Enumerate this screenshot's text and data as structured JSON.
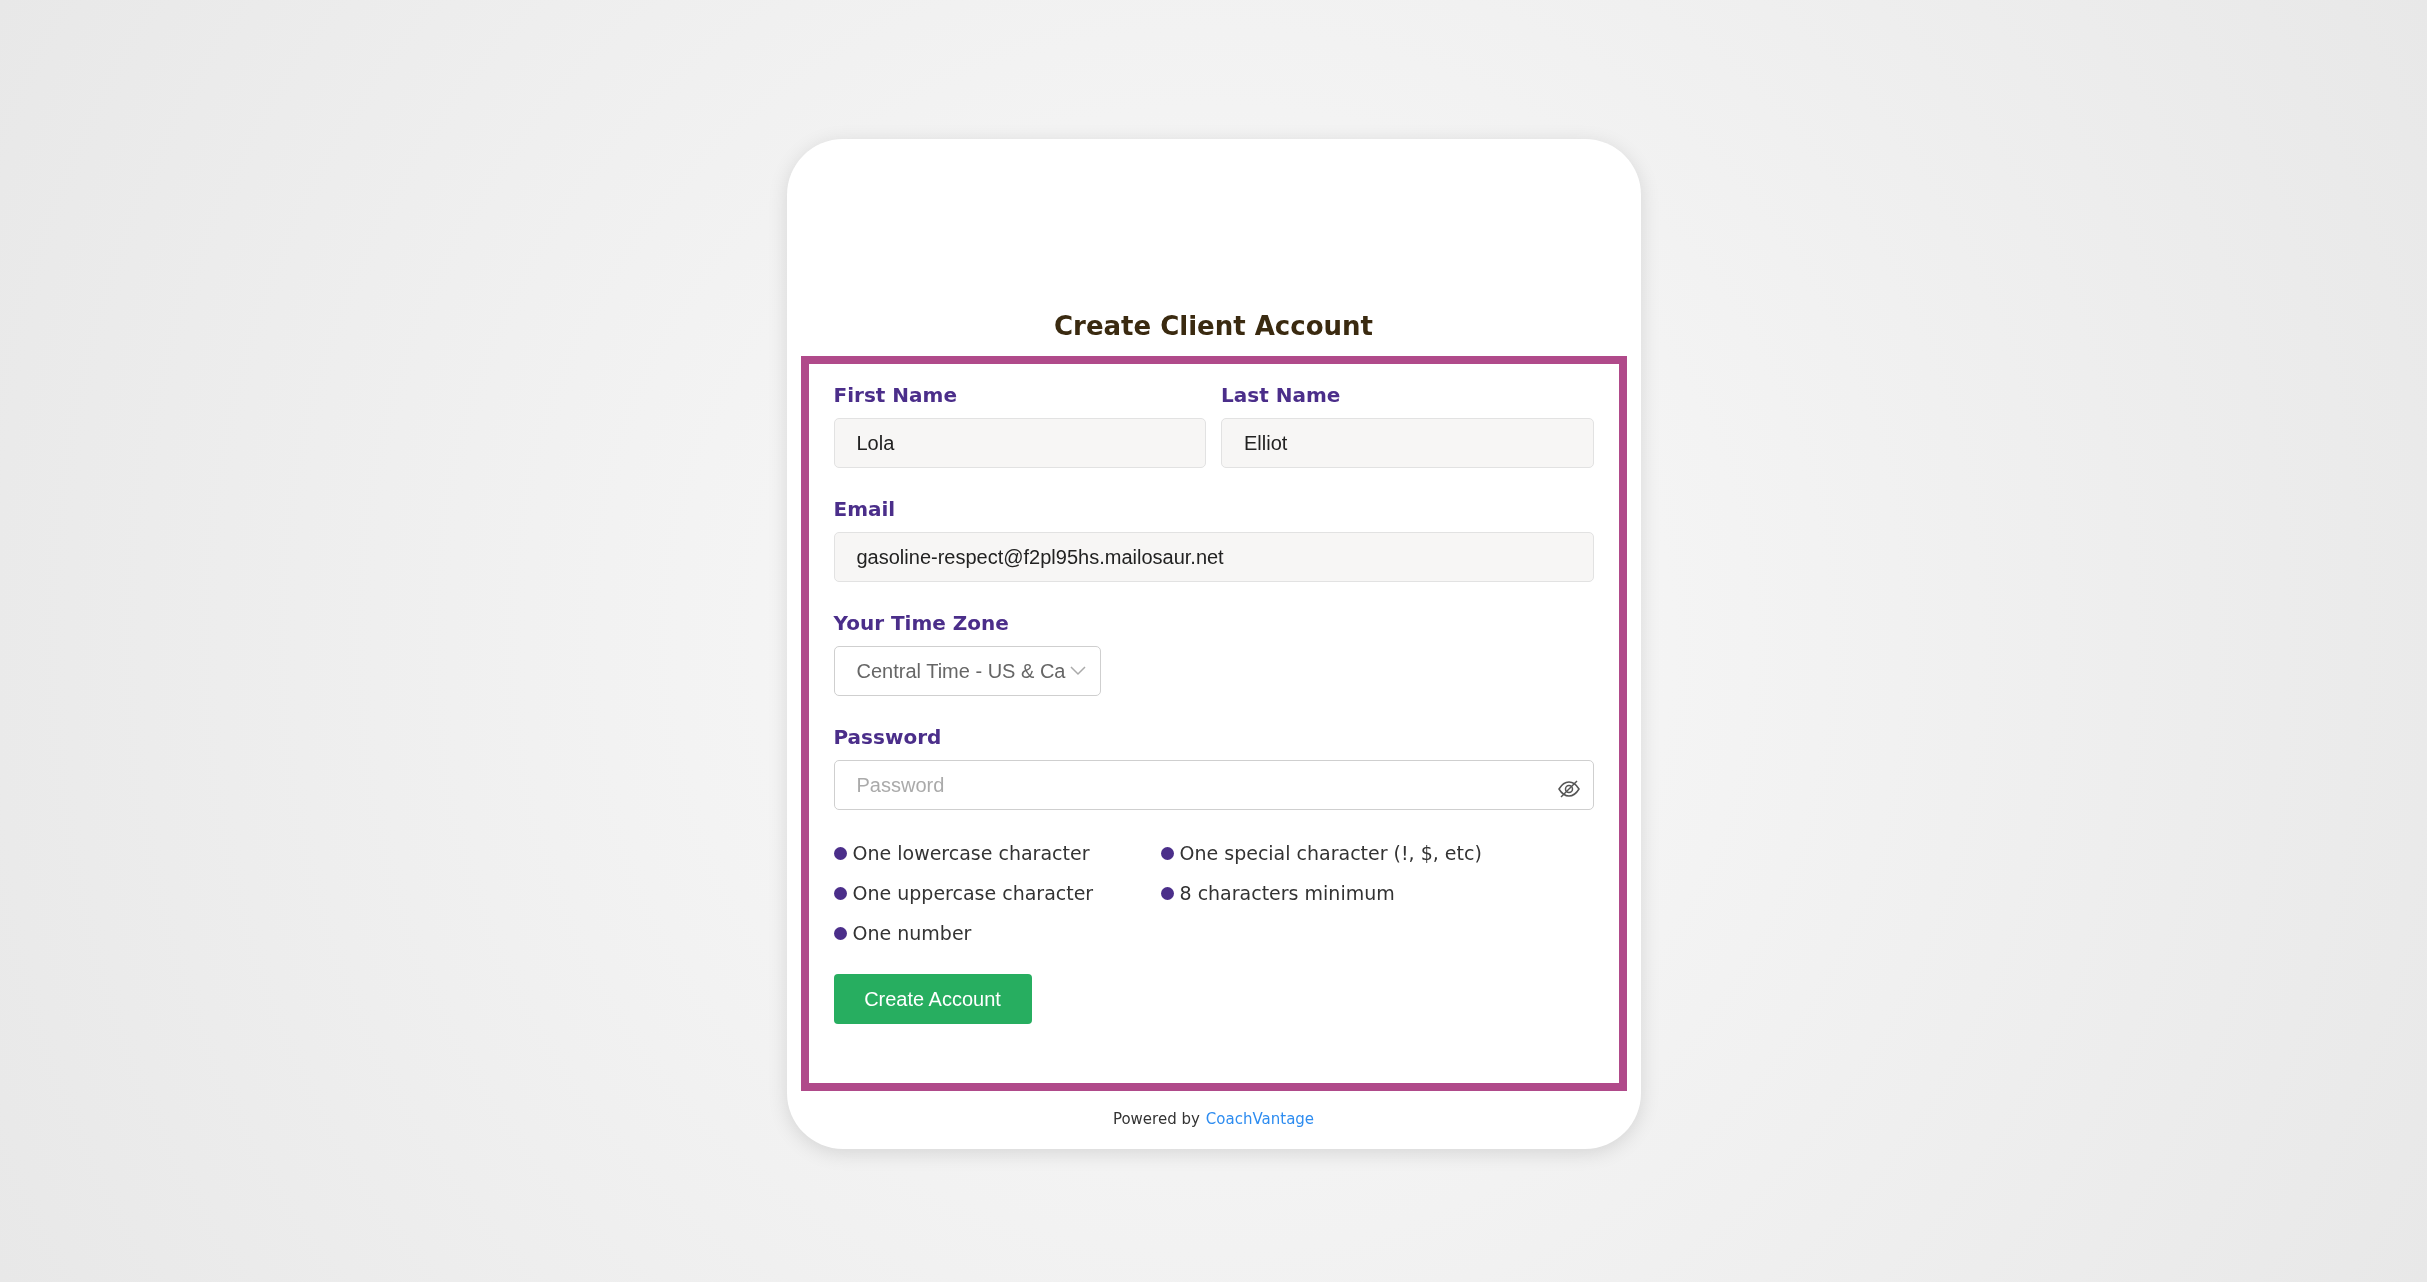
{
  "title": "Create Client Account",
  "fields": [
    {
      "label": "First Name",
      "value": "Lola"
    },
    {
      "label": "Last Name",
      "value": "Elliot"
    }
  ],
  "email": {
    "label": "Email",
    "value": "gasoline-respect@f2pl95hs.mailosaur.net"
  },
  "time_zone": {
    "label": "Your Time Zone",
    "value": "Central Time - US & Ca"
  },
  "password": {
    "label": "Password",
    "placeholder": "Password"
  },
  "requirements": [
    {
      "text": "One lowercase character"
    },
    {
      "text": "One special character (!, $, etc)"
    },
    {
      "text": "One uppercase character"
    },
    {
      "text": "8 characters minimum"
    },
    {
      "text": "One number"
    }
  ],
  "submit_button": "Create Account",
  "footer": {
    "text": "Powered by",
    "link": "CoachVantage"
  }
}
